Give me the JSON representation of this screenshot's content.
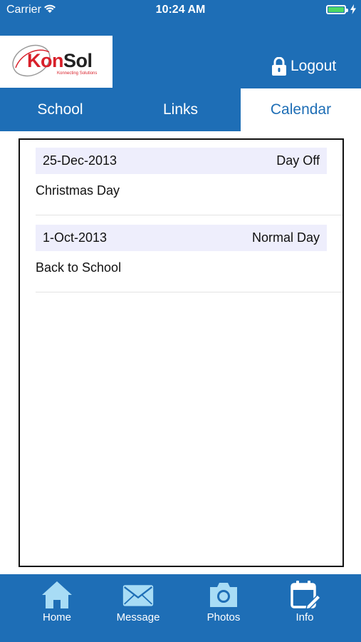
{
  "status_bar": {
    "carrier": "Carrier",
    "time": "10:24 AM"
  },
  "logo": {
    "kon": "Kon",
    "sol": "Sol",
    "tagline": "Konnecting Solutions"
  },
  "header": {
    "logout_label": "Logout"
  },
  "tabs": [
    {
      "label": "School",
      "active": false
    },
    {
      "label": "Links",
      "active": false
    },
    {
      "label": "Calendar",
      "active": true
    }
  ],
  "events": [
    {
      "date": "25-Dec-2013",
      "type": "Day Off",
      "title": "Christmas Day"
    },
    {
      "date": "1-Oct-2013",
      "type": "Normal Day",
      "title": "Back to School"
    }
  ],
  "bottom_nav": [
    {
      "label": "Home",
      "icon": "home-icon"
    },
    {
      "label": "Message",
      "icon": "envelope-icon"
    },
    {
      "label": "Photos",
      "icon": "camera-icon"
    },
    {
      "label": "Info",
      "icon": "calendar-edit-icon"
    }
  ],
  "colors": {
    "primary": "#1e6eb6",
    "icon_light": "#a8dcf5",
    "event_header_bg": "#eeeefc",
    "brand_red": "#d8202a"
  }
}
